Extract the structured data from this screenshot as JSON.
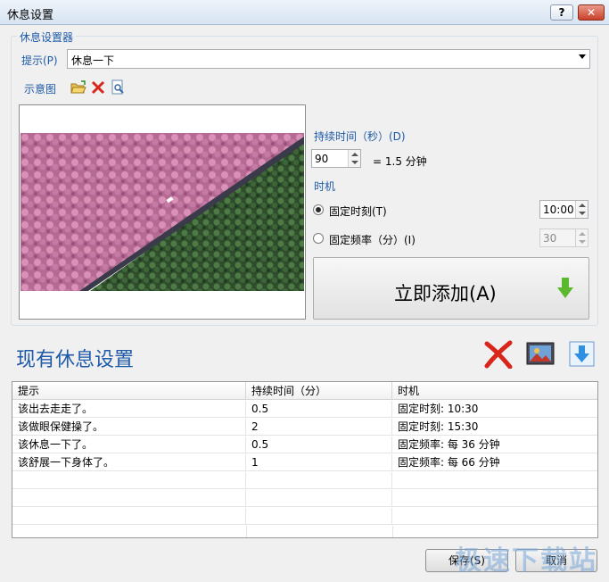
{
  "window": {
    "title": "休息设置",
    "help_label": "?",
    "close_label": "✕"
  },
  "group": {
    "label": "休息设置器"
  },
  "prompt": {
    "label": "提示(P)",
    "value": "休息一下"
  },
  "preview": {
    "label": "示意图"
  },
  "duration": {
    "label": "持续时间（秒）(D)",
    "value": "90",
    "equals": "= 1.5 分钟"
  },
  "timing": {
    "label": "时机",
    "fixed_time_label": "固定时刻(T)",
    "fixed_time_value": "10:00",
    "fixed_freq_label": "固定频率（分）(I)",
    "fixed_freq_value": "30",
    "selected": "fixed_time"
  },
  "add_button": {
    "label": "立即添加(A)"
  },
  "existing": {
    "title": "现有休息设置"
  },
  "table": {
    "headers": [
      "提示",
      "持续时间（分）",
      "时机"
    ],
    "rows": [
      [
        "该出去走走了。",
        "0.5",
        "固定时刻: 10:30"
      ],
      [
        "该做眼保健操了。",
        "2",
        "固定时刻: 15:30"
      ],
      [
        "该休息一下了。",
        "0.5",
        "固定频率: 每 36 分钟"
      ],
      [
        "该舒展一下身体了。",
        "1",
        "固定频率: 每 66 分钟"
      ]
    ]
  },
  "footer": {
    "save_label": "保存(S)",
    "cancel_label": "取消"
  },
  "watermark": "极速下载站",
  "colors": {
    "accent": "#1e5aa8",
    "arrow_green": "#5cb82c",
    "delete_red": "#d8261a",
    "download_blue": "#2f8fe0"
  }
}
